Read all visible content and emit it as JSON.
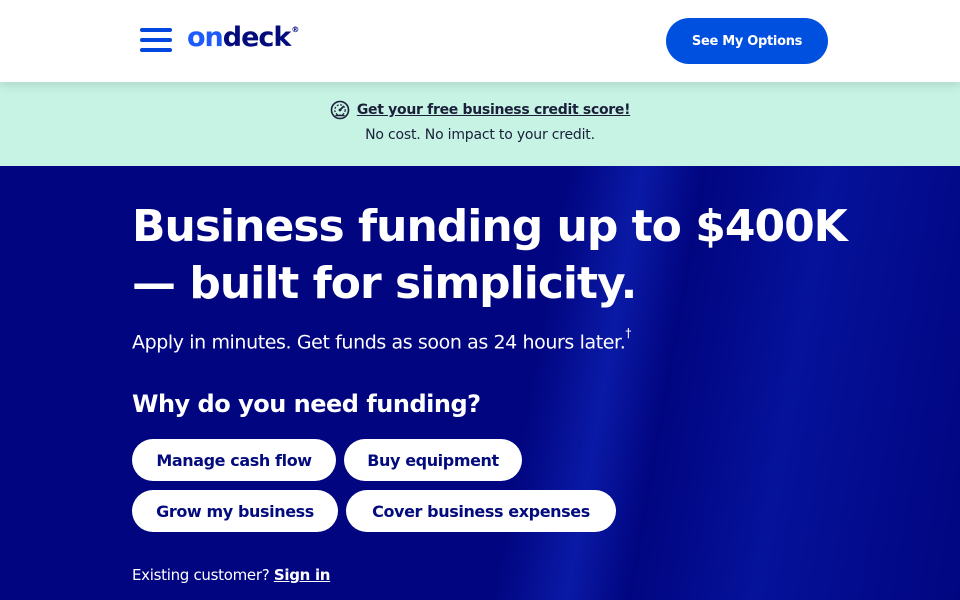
{
  "header": {
    "logo_on": "on",
    "logo_deck": "deck",
    "logo_reg": "®",
    "cta_label": "See My Options"
  },
  "banner": {
    "link_text": "Get your free business credit score!",
    "subtext": "No cost. No impact to your credit.",
    "icon": "gauge-icon"
  },
  "hero": {
    "headline": "Business funding up to $400K — built for simplicity.",
    "subhead": "Apply in minutes. Get funds as soon as 24 hours later.",
    "subhead_mark": "†",
    "question": "Why do you need funding?",
    "options": [
      "Manage cash flow",
      "Buy equipment",
      "Grow my business",
      "Cover business expenses"
    ],
    "existing_label": "Existing customer?",
    "signin_label": "Sign in"
  },
  "colors": {
    "brand_blue": "#0050e0",
    "navy": "#010580",
    "banner_bg": "#c6f3e3"
  }
}
